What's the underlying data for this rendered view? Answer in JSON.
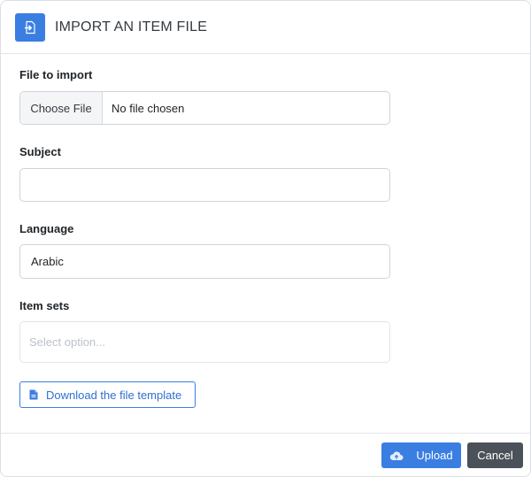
{
  "dialog": {
    "title": "IMPORT AN ITEM FILE",
    "header_icon": "file-import-icon",
    "accent_color": "#3a7ee2"
  },
  "form": {
    "file": {
      "label": "File to import",
      "button_label": "Choose File",
      "status": "No file chosen"
    },
    "subject": {
      "label": "Subject",
      "value": ""
    },
    "language": {
      "label": "Language",
      "value": "Arabic"
    },
    "item_sets": {
      "label": "Item sets",
      "placeholder": "Select option..."
    },
    "download_template": {
      "label": "Download the file template",
      "icon": "document-icon"
    }
  },
  "footer": {
    "upload_label": "Upload",
    "upload_icon": "cloud-upload-icon",
    "cancel_label": "Cancel"
  }
}
